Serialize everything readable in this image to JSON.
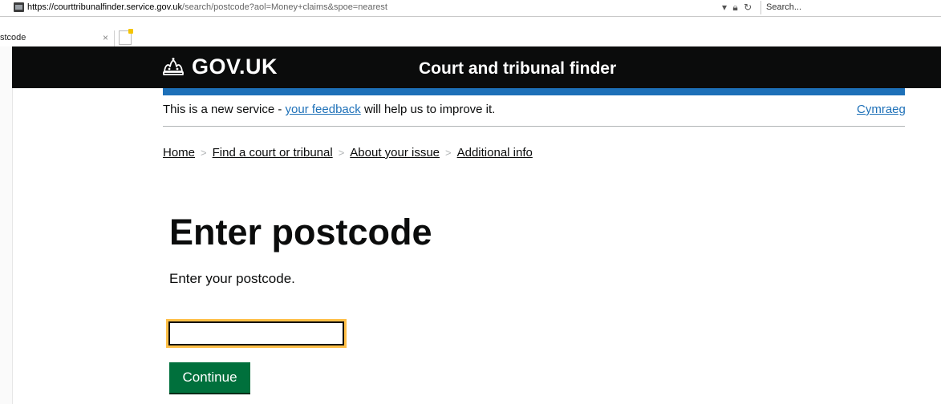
{
  "browser": {
    "url_domain": "https://courttribunalfinder.service.gov.uk",
    "url_path": "/search/postcode?aol=Money+claims&spoe=nearest",
    "search_placeholder": "Search...",
    "tab_title": "stcode",
    "tab_close": "×"
  },
  "header": {
    "logo": "GOV.UK",
    "service_name": "Court and tribunal finder"
  },
  "phase_banner": {
    "prefix": "This is a new service - ",
    "link": "your feedback",
    "suffix": " will help us to improve it.",
    "language": "Cymraeg"
  },
  "breadcrumbs": [
    {
      "label": "Home"
    },
    {
      "label": "Find a court or tribunal"
    },
    {
      "label": "About your issue"
    },
    {
      "label": "Additional info"
    }
  ],
  "main": {
    "title": "Enter postcode",
    "hint": "Enter your postcode.",
    "input_value": "",
    "button_label": "Continue"
  },
  "colors": {
    "header_bg": "#0b0c0c",
    "blue_bar": "#1d70b8",
    "link": "#1d70b8",
    "button": "#00703c",
    "focus": "#ffbf47"
  },
  "icons": {
    "site": "site-identity-icon",
    "lock": "lock-icon",
    "reload": "reload-icon",
    "dropdown": "dropdown-arrow-icon",
    "crown": "crown-icon",
    "new_tab": "new-tab-icon"
  }
}
